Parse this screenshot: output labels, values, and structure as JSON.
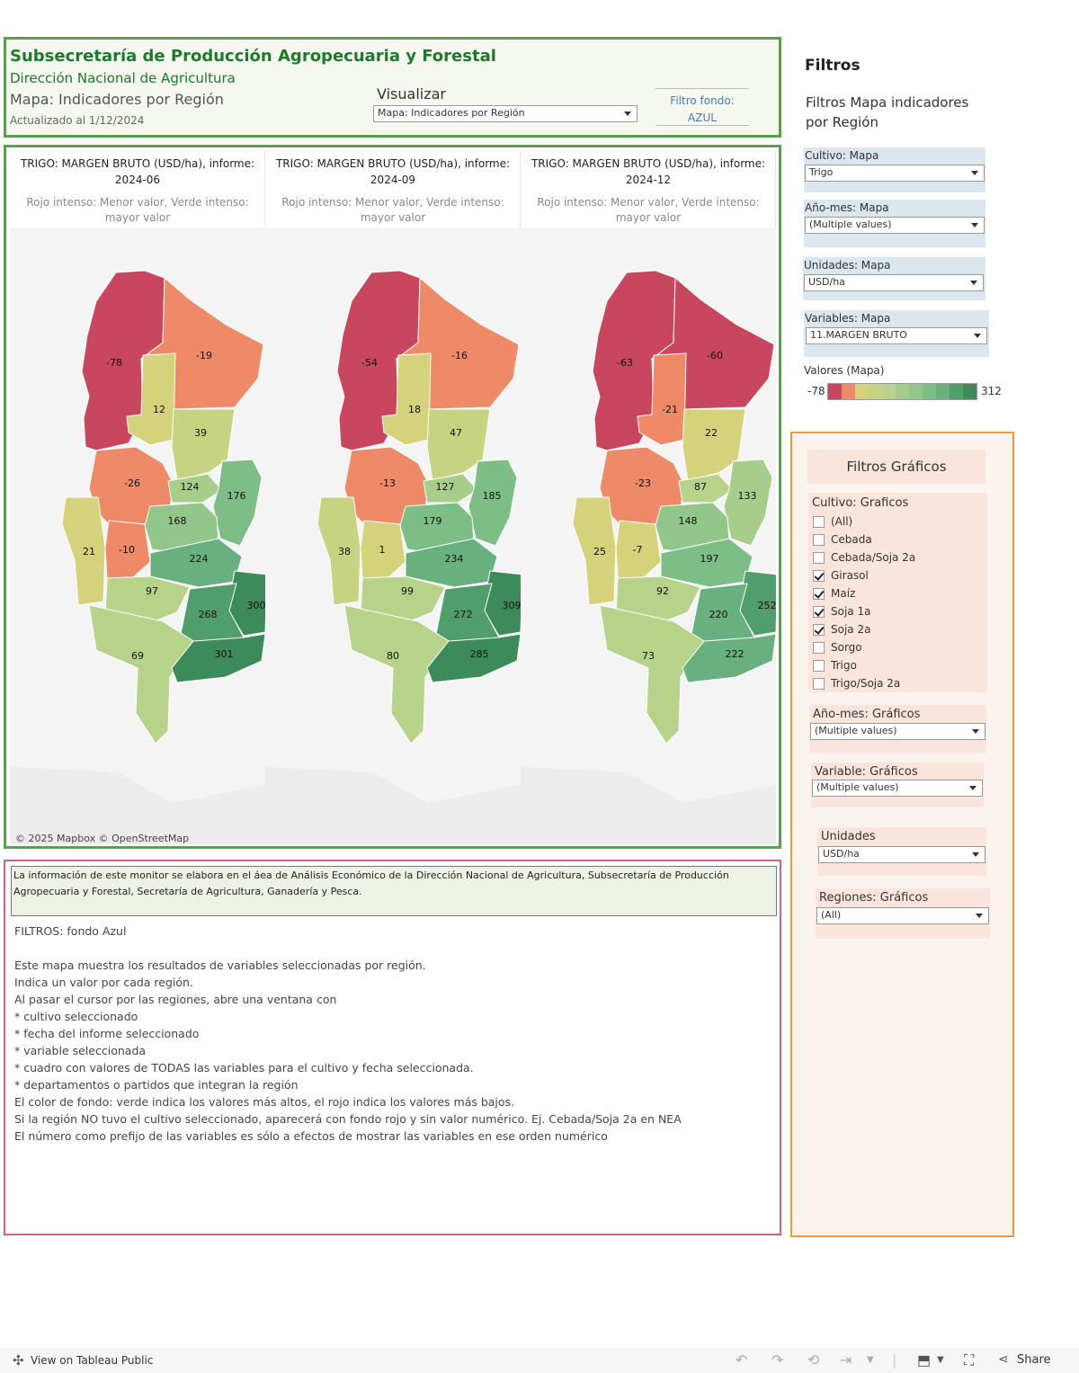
{
  "header": {
    "title1": "Subsecretaría de Producción Agropecuaria y Forestal",
    "title2": "Dirección Nacional de Agricultura",
    "title3": "Mapa: Indicadores por Región",
    "updated": "Actualizado al 1/12/2024",
    "visualizar_label": "Visualizar",
    "visualizar_value": "Mapa: Indicadores por Región",
    "filtro_fondo_line1": "Filtro fondo:",
    "filtro_fondo_line2": "AZUL"
  },
  "maps": [
    {
      "title_line1": "TRIGO:  MARGEN BRUTO  (USD/ha), informe:",
      "title_line2": "2024-06",
      "subtitle": "Rojo intenso: Menor valor, Verde intenso: mayor valor",
      "regions": {
        "nw": -78,
        "ne": -19,
        "c1": 12,
        "c2": 39,
        "w": -26,
        "c3": 124,
        "e": 176,
        "c4": 168,
        "sw": 21,
        "s1": -10,
        "s2": 224,
        "s3": 97,
        "se": 300,
        "s4": 268,
        "s5": 69,
        "s6": 301
      }
    },
    {
      "title_line1": "TRIGO:  MARGEN BRUTO  (USD/ha), informe:",
      "title_line2": "2024-09",
      "subtitle": "Rojo intenso: Menor valor, Verde intenso: mayor valor",
      "regions": {
        "nw": -54,
        "ne": -16,
        "c1": 18,
        "c2": 47,
        "w": -13,
        "c3": 127,
        "e": 185,
        "c4": 179,
        "sw": 38,
        "s1": 1,
        "s2": 234,
        "s3": 99,
        "se": 309,
        "s4": 272,
        "s5": 80,
        "s6": 285
      }
    },
    {
      "title_line1": "TRIGO:  MARGEN BRUTO  (USD/ha), informe:",
      "title_line2": "2024-12",
      "subtitle": "Rojo intenso: Menor valor, Verde intenso: mayor valor",
      "regions": {
        "nw": -63,
        "ne": -60,
        "c1": -21,
        "c2": 22,
        "w": -23,
        "c3": 87,
        "e": 133,
        "c4": 148,
        "sw": 25,
        "s1": -7,
        "s2": 197,
        "s3": 92,
        "se": 252,
        "s4": 220,
        "s5": 73,
        "s6": 222
      }
    }
  ],
  "attribution": "© 2025 Mapbox  © OpenStreetMap",
  "info": {
    "box_text": "La información de este monitor se elabora en el áea de Análisis Económico de la Dirección Nacional de Agricultura, Subsecretaría de Producción Agropecuaria y Forestal, Secretaría de Agricultura, Ganadería y Pesca.",
    "lines": [
      "FILTROS: fondo Azul",
      "",
      "Este mapa muestra los resultados de variables seleccionadas por región.",
      "Indica un valor por cada región.",
      "Al pasar el cursor por las regiones, abre una ventana con",
      "* cultivo seleccionado",
      "* fecha del informe seleccionado",
      "* variable seleccionada",
      "* cuadro con valores de TODAS las variables para el cultivo y fecha seleccionada.",
      "* departamentos o partidos que integran la región",
      "El color de fondo: verde indica los valores más altos, el rojo indica los valores más bajos.",
      "Si la región NO tuvo el cultivo seleccionado, aparecerá con fondo rojo y sin valor numérico. Ej. Cebada/Soja 2a en NEA",
      "El número como prefijo de las variables es sólo a efectos de mostrar las variables en ese orden numérico"
    ]
  },
  "sidebar": {
    "heading": "Filtros",
    "subheading": "Filtros Mapa indicadores por Región",
    "cultivo_label": "Cultivo: Mapa",
    "cultivo_value": "Trigo",
    "anio_label": "Año-mes: Mapa",
    "anio_value": "(Multiple values)",
    "unidades_label": "Unidades: Mapa",
    "unidades_value": "USD/ha",
    "variables_label": "Variables: Mapa",
    "variables_value": "11.MARGEN BRUTO",
    "legend_label": "Valores (Mapa)",
    "legend_min": "-78",
    "legend_max": "312",
    "legend_colors": [
      "#c9475e",
      "#ee8a68",
      "#d4d27a",
      "#c6d482",
      "#b7d38a",
      "#a6cd8a",
      "#92c68a",
      "#7dbd86",
      "#68b07e",
      "#4f9e6b",
      "#3d8b5a"
    ]
  },
  "graficos": {
    "title": "Filtros Gráficos",
    "cultivo_label": "Cultivo: Graficos",
    "cultivo_items": [
      {
        "label": "(All)",
        "checked": false
      },
      {
        "label": "Cebada",
        "checked": false
      },
      {
        "label": "Cebada/Soja 2a",
        "checked": false
      },
      {
        "label": "Girasol",
        "checked": true
      },
      {
        "label": "Maíz",
        "checked": true
      },
      {
        "label": "Soja 1a",
        "checked": true
      },
      {
        "label": "Soja 2a",
        "checked": true
      },
      {
        "label": "Sorgo",
        "checked": false
      },
      {
        "label": "Trigo",
        "checked": false
      },
      {
        "label": "Trigo/Soja 2a",
        "checked": false
      }
    ],
    "anio_label": "Año-mes: Gráficos",
    "anio_value": "(Multiple values)",
    "variable_label": "Variable: Gráficos",
    "variable_value": "(Multiple values)",
    "unidades_label": "Unidades",
    "unidades_value": "USD/ha",
    "regiones_label": "Regiones: Gráficos",
    "regiones_value": "(All)"
  },
  "bottombar": {
    "view_label": "View on Tableau Public",
    "share_label": "Share"
  }
}
